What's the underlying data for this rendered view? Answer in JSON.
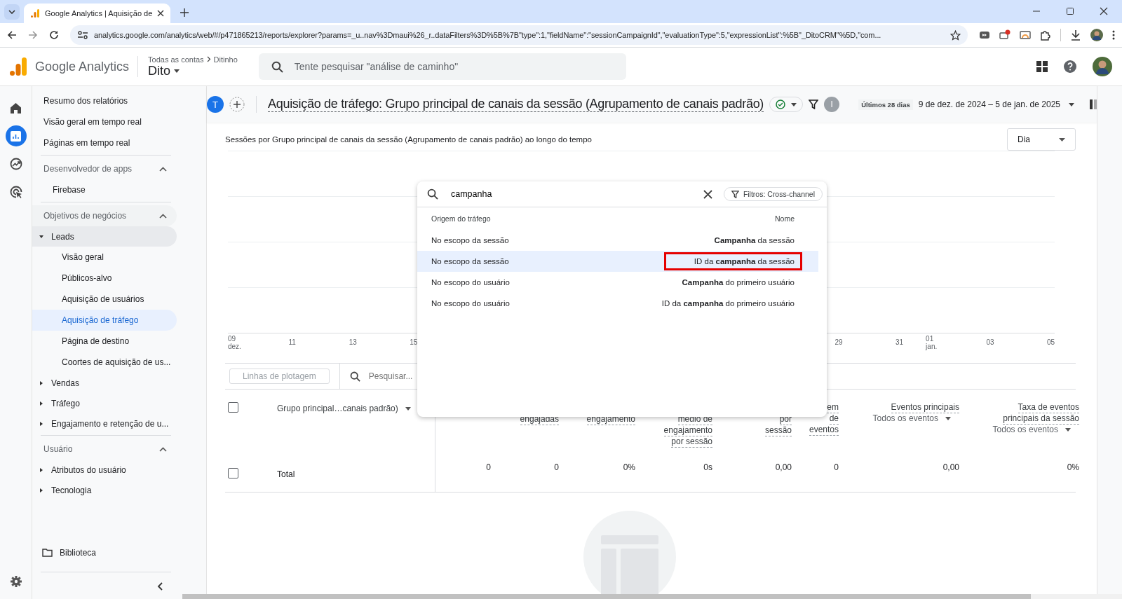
{
  "browser": {
    "tab_title": "Google Analytics | Aquisição de",
    "url": "analytics.google.com/analytics/web/#/p471865213/reports/explorer?params=_u..nav%3Dmaui%26_r..dataFilters%3D%5B%7B\"type\":1,\"fieldName\":\"sessionCampaignId\",\"evaluationType\":5,\"expressionList\":%5B\"_DitoCRM\"%5D,\"com..."
  },
  "header": {
    "product": "Google Analytics",
    "breadcrumb": [
      "Todas as contas",
      "Ditinho"
    ],
    "property": "Dito",
    "search_placeholder": "Tente pesquisar \"análise de caminho\""
  },
  "rail": [
    {
      "kind": "home",
      "selected": false
    },
    {
      "kind": "reports",
      "selected": true
    },
    {
      "kind": "explore",
      "selected": false
    },
    {
      "kind": "advertising",
      "selected": false
    }
  ],
  "sidebar": {
    "top_items": [
      {
        "label": "Resumo dos relatórios",
        "selected": false
      },
      {
        "label": "Visão geral em tempo real",
        "selected": false
      },
      {
        "label": "Páginas em tempo real",
        "selected": false
      }
    ],
    "sections": [
      {
        "title": "Desenvolvedor de apps",
        "expanded": true,
        "items": [
          {
            "label": "Firebase",
            "selected": false
          }
        ]
      },
      {
        "title": "Objetivos de negócios",
        "expanded": true,
        "items": [
          {
            "label": "Leads",
            "expanded": true,
            "children": [
              {
                "label": "Visão geral",
                "selected": false
              },
              {
                "label": "Públicos-alvo",
                "selected": false
              },
              {
                "label": "Aquisição de usuários",
                "selected": false
              },
              {
                "label": "Aquisição de tráfego",
                "selected": true
              },
              {
                "label": "Página de destino",
                "selected": false
              },
              {
                "label": "Coortes de aquisição de us...",
                "selected": false
              }
            ]
          },
          {
            "label": "Vendas",
            "expanded": false
          },
          {
            "label": "Tráfego",
            "expanded": false
          },
          {
            "label": "Engajamento e retenção de u...",
            "expanded": false
          }
        ]
      },
      {
        "title": "Usuário",
        "expanded": true,
        "items": [
          {
            "label": "Atributos do usuário",
            "expanded": false
          },
          {
            "label": "Tecnologia",
            "expanded": false
          }
        ]
      }
    ],
    "library": "Biblioteca"
  },
  "report": {
    "comparison": "T",
    "title": "Aquisição de tráfego: Grupo principal de canais da sessão (Agrupamento de canais padrão)",
    "filter_badge": "I",
    "date_label": "Últimos 28 dias",
    "date_range": "9 de dez. de 2024 – 5 de jan. de 2025"
  },
  "chart": {
    "title": "Sessões por Grupo principal de canais da sessão (Agrupamento de canais padrão) ao longo do tempo",
    "granularity": "Dia",
    "ticks_start": [
      {
        "day": "09",
        "month": "dez."
      },
      {
        "day": "11"
      },
      {
        "day": "13"
      },
      {
        "day": "15"
      }
    ],
    "ticks_end": [
      {
        "day": "29"
      },
      {
        "day": "31"
      },
      {
        "day": "01",
        "month": "jan."
      },
      {
        "day": "03"
      },
      {
        "day": "05"
      }
    ]
  },
  "table": {
    "plot_button": {
      "label": "Linhas de plotagem",
      "disabled": true
    },
    "search_placeholder": "Pesquisar...",
    "dimension_header": "Grupo principal…canais padrão)",
    "header_checked": false,
    "columns": [
      {
        "lines": [
          "engajadas"
        ],
        "covered": true
      },
      {
        "lines": [
          "engajamento"
        ],
        "covered": true
      },
      {
        "lines": [
          "médio de",
          "engajamento",
          "por sessão"
        ],
        "covered": true
      },
      {
        "lines": [
          "por",
          "sessão"
        ],
        "covered": true
      },
      {
        "lines": [
          "em",
          "de",
          "eventos"
        ],
        "covered": false
      },
      {
        "lines": [
          "Eventos principais"
        ],
        "filter": "Todos os eventos"
      },
      {
        "lines": [
          "Taxa de eventos",
          "principais da sessão"
        ],
        "filter": "Todos os eventos"
      }
    ],
    "total_label": "Total",
    "total_checked": false,
    "totals": [
      "0",
      "0",
      "0%",
      "0s",
      "0,00",
      "0",
      "0,00",
      "0%"
    ]
  },
  "popup": {
    "query": "campanha",
    "filter_chip": "Filtros: Cross-channel",
    "columns": [
      "Origem do tráfego",
      "Nome"
    ],
    "rows": [
      {
        "scope": "No escopo da sessão",
        "name": "**Campanha** da sessão",
        "selected": false,
        "highlighted": false
      },
      {
        "scope": "No escopo da sessão",
        "name": "ID da **campanha** da sessão",
        "selected": true,
        "highlighted": true
      },
      {
        "scope": "No escopo do usuário",
        "name": "**Campanha** do primeiro usuário",
        "selected": false,
        "highlighted": false
      },
      {
        "scope": "No escopo do usuário",
        "name": "ID da **campanha** do primeiro usuário",
        "selected": false,
        "highlighted": false
      }
    ]
  }
}
